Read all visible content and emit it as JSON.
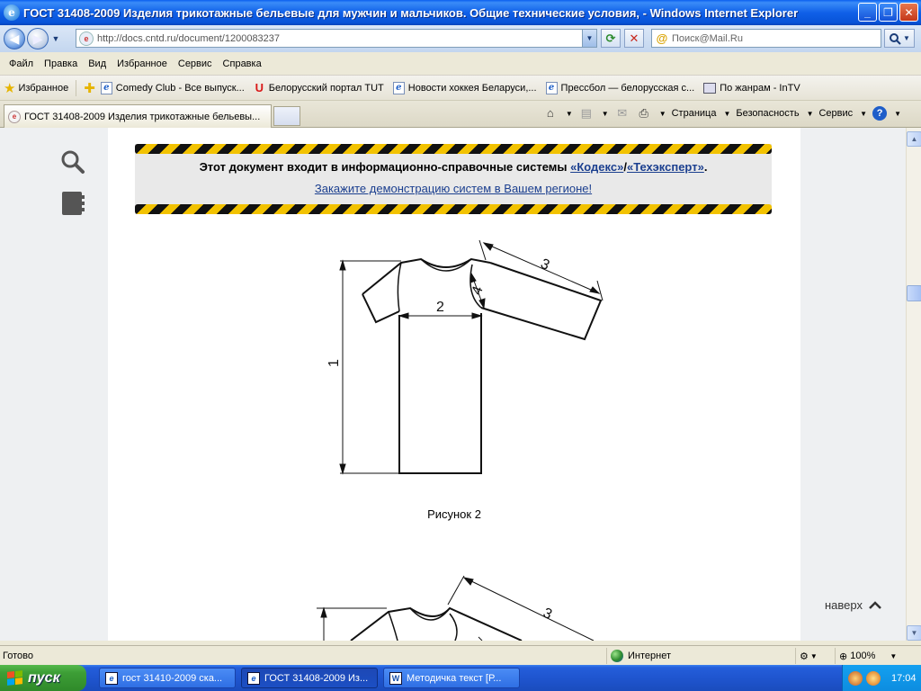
{
  "window": {
    "title": "ГОСТ 31408-2009 Изделия трикотажные бельевые для мужчин и мальчиков. Общие технические условия, - Windows Internet Explorer"
  },
  "address": {
    "url": "http://docs.cntd.ru/document/1200083237",
    "search_placeholder": "Поиск@Mail.Ru"
  },
  "menu": [
    "Файл",
    "Правка",
    "Вид",
    "Избранное",
    "Сервис",
    "Справка"
  ],
  "favorites": {
    "main_label": "Избранное",
    "items": [
      "Comedy Club - Все выпуск...",
      "Белорусский портал TUT",
      "Новости хоккея Беларуси,...",
      "Прессбол — белорусская с...",
      "По жанрам - InTV"
    ]
  },
  "tab": {
    "title": "ГОСТ 31408-2009 Изделия трикотажные бельевы..."
  },
  "commandbar": {
    "page": "Страница",
    "safety": "Безопасность",
    "tools": "Сервис"
  },
  "banner": {
    "text_prefix": "Этот документ входит в информационно-справочные системы",
    "link1": "«Кодекс»",
    "separator": "/",
    "link2": "«Техэксперт»",
    "suffix": ".",
    "line2": "Закажите демонстрацию систем в Вашем регионе!"
  },
  "figure": {
    "caption": "Рисунок 2",
    "labels": [
      "1",
      "2",
      "3",
      "4"
    ],
    "labels_second": [
      "3"
    ]
  },
  "page_nav": {
    "to_top": "наверх"
  },
  "status": {
    "text": "Готово",
    "zone": "Интернет",
    "zoom": "100%"
  },
  "taskbar": {
    "start": "пуск",
    "tasks": [
      "гост 31410-2009 ска...",
      "ГОСТ 31408-2009 Из...",
      "Методичка текст [Р..."
    ],
    "clock": "17:04"
  },
  "colors": {
    "title_blue": "#0753d8",
    "hazard_yellow": "#f2c200",
    "link_blue": "#1b3f8f",
    "start_green": "#3d9e36"
  }
}
